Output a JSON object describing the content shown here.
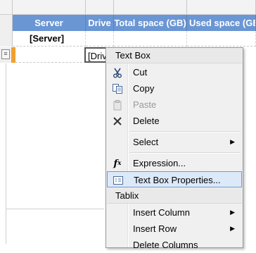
{
  "table": {
    "headers": [
      "Server",
      "Drive",
      "Total space (GB)",
      "Used space (GB)"
    ],
    "group_row": {
      "server": "[Server]"
    },
    "detail_row": {
      "drive": "[Driv"
    }
  },
  "context_menu": {
    "sections": [
      {
        "header": "Text Box",
        "items": [
          {
            "label": "Cut",
            "icon": "cut-icon"
          },
          {
            "label": "Copy",
            "icon": "copy-icon"
          },
          {
            "label": "Paste",
            "icon": "paste-icon",
            "disabled": true
          },
          {
            "label": "Delete",
            "icon": "delete-icon"
          },
          {
            "label": "Select",
            "submenu": true
          },
          {
            "label": "Expression...",
            "icon": "expression-icon"
          },
          {
            "label": "Text Box Properties...",
            "icon": "properties-icon",
            "highlighted": true
          }
        ]
      },
      {
        "header": "Tablix",
        "items": [
          {
            "label": "Insert Column",
            "submenu": true
          },
          {
            "label": "Insert Row",
            "submenu": true
          },
          {
            "label": "Delete Columns"
          }
        ]
      }
    ]
  },
  "colors": {
    "header_fill": "#6b96d4",
    "highlight_fill": "#dce9f9",
    "highlight_border": "#6a9ad8",
    "row_marker": "#f0a030"
  }
}
